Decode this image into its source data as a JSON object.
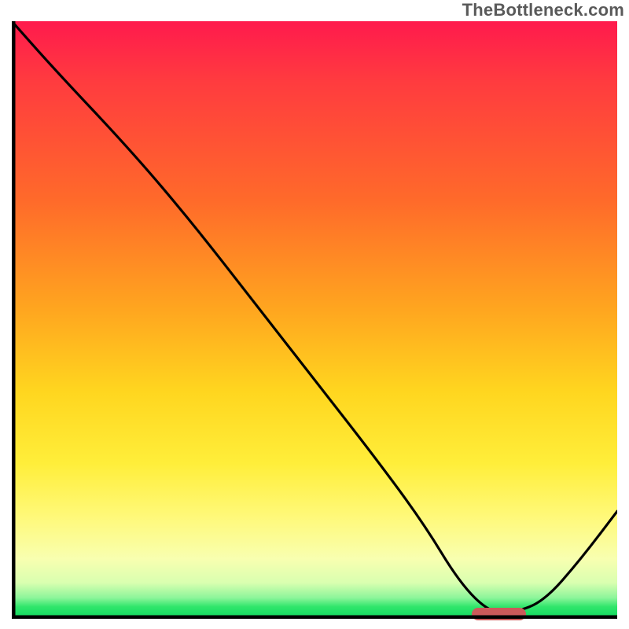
{
  "watermark": "TheBottleneck.com",
  "colors": {
    "axis": "#000000",
    "curve": "#000000",
    "marker": "#cc5a5a",
    "gradient_top": "#ff1a4d",
    "gradient_mid": "#ffd61f",
    "gradient_bottom": "#0fd85f"
  },
  "chart_data": {
    "type": "line",
    "title": "",
    "xlabel": "",
    "ylabel": "",
    "xlim": [
      0,
      100
    ],
    "ylim": [
      0,
      100
    ],
    "grid": false,
    "legend": false,
    "series": [
      {
        "name": "bottleneck-curve",
        "x": [
          0,
          7,
          20,
          30,
          40,
          50,
          60,
          68,
          74,
          79,
          83,
          88,
          94,
          100
        ],
        "y": [
          100,
          92,
          78,
          66,
          53,
          40,
          27,
          16,
          6,
          1,
          1,
          3,
          10,
          18
        ]
      }
    ],
    "optimal_marker": {
      "x_start": 76,
      "x_end": 85,
      "y": 0.8
    },
    "background_gradient": {
      "stops": [
        {
          "pos": 0.0,
          "color": "#ff1a4d"
        },
        {
          "pos": 0.3,
          "color": "#ff6a2a"
        },
        {
          "pos": 0.62,
          "color": "#ffd61f"
        },
        {
          "pos": 0.9,
          "color": "#f8ffb0"
        },
        {
          "pos": 1.0,
          "color": "#0fd85f"
        }
      ]
    }
  }
}
